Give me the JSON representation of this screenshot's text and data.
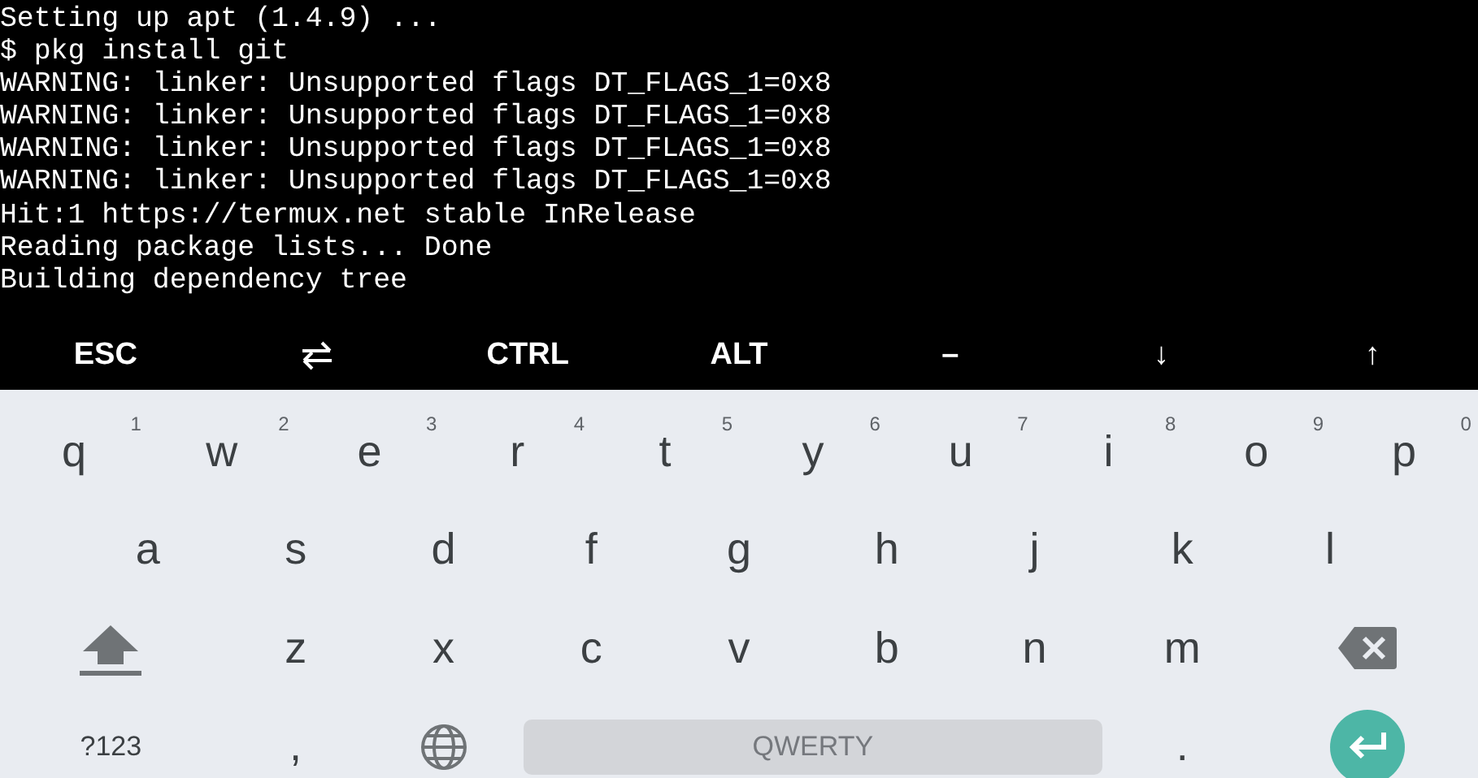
{
  "terminal": {
    "lines": [
      "Setting up apt (1.4.9) ...",
      "$ pkg install git",
      "WARNING: linker: Unsupported flags DT_FLAGS_1=0x8",
      "WARNING: linker: Unsupported flags DT_FLAGS_1=0x8",
      "WARNING: linker: Unsupported flags DT_FLAGS_1=0x8",
      "WARNING: linker: Unsupported flags DT_FLAGS_1=0x8",
      "Hit:1 https://termux.net stable InRelease",
      "Reading package lists... Done",
      "Building dependency tree"
    ]
  },
  "extra_keys": [
    {
      "kind": "text",
      "label": "ESC"
    },
    {
      "kind": "swap"
    },
    {
      "kind": "text",
      "label": "CTRL"
    },
    {
      "kind": "text",
      "label": "ALT"
    },
    {
      "kind": "text",
      "label": "–"
    },
    {
      "kind": "text",
      "label": "↓"
    },
    {
      "kind": "text",
      "label": "↑"
    }
  ],
  "keyboard": {
    "rows": [
      {
        "keys": [
          {
            "kind": "letter",
            "label": "q",
            "hint": "1"
          },
          {
            "kind": "letter",
            "label": "w",
            "hint": "2"
          },
          {
            "kind": "letter",
            "label": "e",
            "hint": "3"
          },
          {
            "kind": "letter",
            "label": "r",
            "hint": "4"
          },
          {
            "kind": "letter",
            "label": "t",
            "hint": "5"
          },
          {
            "kind": "letter",
            "label": "y",
            "hint": "6"
          },
          {
            "kind": "letter",
            "label": "u",
            "hint": "7"
          },
          {
            "kind": "letter",
            "label": "i",
            "hint": "8"
          },
          {
            "kind": "letter",
            "label": "o",
            "hint": "9"
          },
          {
            "kind": "letter",
            "label": "p",
            "hint": "0"
          }
        ]
      },
      {
        "keys": [
          {
            "kind": "letter",
            "label": "a"
          },
          {
            "kind": "letter",
            "label": "s"
          },
          {
            "kind": "letter",
            "label": "d"
          },
          {
            "kind": "letter",
            "label": "f"
          },
          {
            "kind": "letter",
            "label": "g"
          },
          {
            "kind": "letter",
            "label": "h"
          },
          {
            "kind": "letter",
            "label": "j"
          },
          {
            "kind": "letter",
            "label": "k"
          },
          {
            "kind": "letter",
            "label": "l"
          }
        ]
      },
      {
        "keys": [
          {
            "kind": "shift"
          },
          {
            "kind": "letter",
            "label": "z"
          },
          {
            "kind": "letter",
            "label": "x"
          },
          {
            "kind": "letter",
            "label": "c"
          },
          {
            "kind": "letter",
            "label": "v"
          },
          {
            "kind": "letter",
            "label": "b"
          },
          {
            "kind": "letter",
            "label": "n"
          },
          {
            "kind": "letter",
            "label": "m"
          },
          {
            "kind": "backspace"
          }
        ]
      },
      {
        "keys": [
          {
            "kind": "symbols",
            "label": "?123"
          },
          {
            "kind": "letter",
            "label": ","
          },
          {
            "kind": "globe"
          },
          {
            "kind": "space",
            "label": "QWERTY"
          },
          {
            "kind": "letter",
            "label": "."
          },
          {
            "kind": "enter"
          }
        ]
      }
    ]
  }
}
